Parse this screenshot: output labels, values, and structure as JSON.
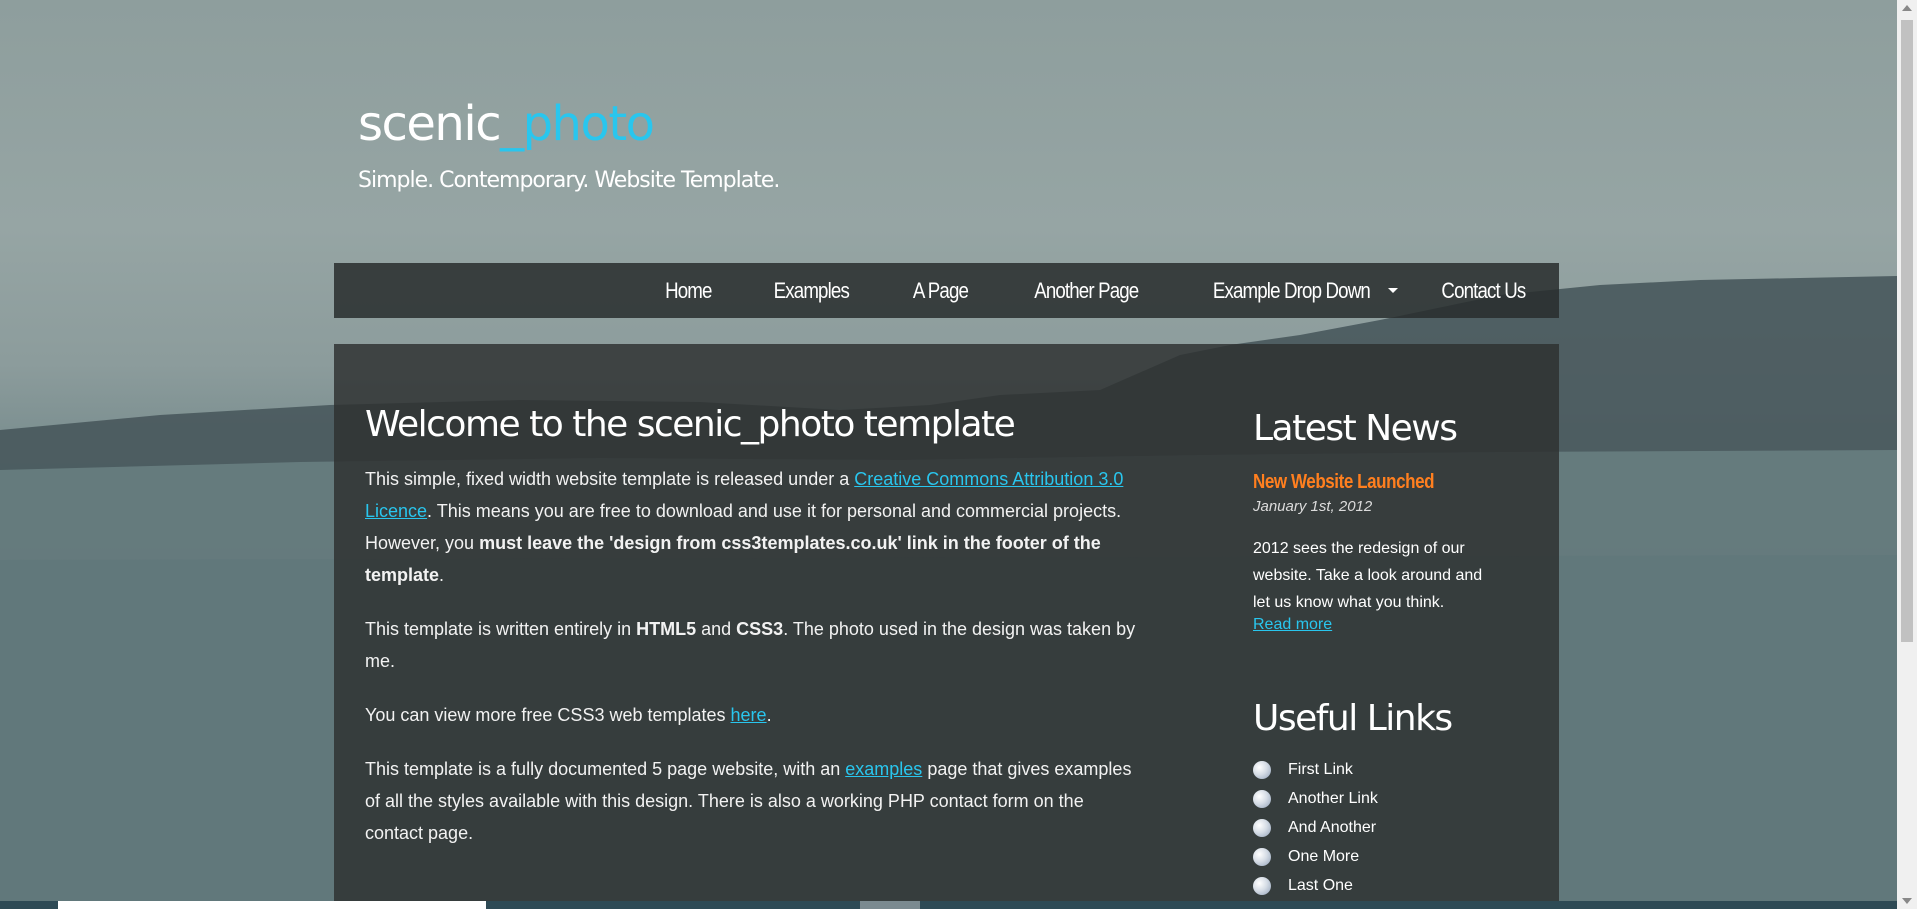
{
  "header": {
    "title_main": "scenic",
    "title_accent": "_photo",
    "slogan": "Simple. Contemporary. Website Template."
  },
  "nav": {
    "items": [
      {
        "label": "Home"
      },
      {
        "label": "Examples"
      },
      {
        "label": "A Page"
      },
      {
        "label": "Another Page"
      },
      {
        "label": "Example Drop Down"
      },
      {
        "label": "Contact Us"
      }
    ]
  },
  "content": {
    "heading": "Welcome to the scenic_photo template",
    "p1": {
      "text_a": "This simple, fixed width website template is released under a ",
      "link": "Creative Commons Attribution 3.0 Licence",
      "text_b": ". This means you are free to download and use it for personal and commercial projects. However, you ",
      "bold": "must leave the 'design from css3templates.co.uk' link in the footer of the template",
      "text_c": "."
    },
    "p2": {
      "text_a": "This template is written entirely in ",
      "bold_a": "HTML5",
      "text_b": " and ",
      "bold_b": "CSS3",
      "text_c": ". The photo used in the design was taken by me."
    },
    "p3": {
      "text_a": "You can view more free CSS3 web templates ",
      "link": "here",
      "text_b": "."
    },
    "p4": {
      "text_a": "This template is a fully documented 5 page website, with an ",
      "link": "examples",
      "text_b": " page that gives examples of all the styles available with this design. There is also a working PHP contact form on the contact page."
    }
  },
  "sidebar": {
    "news_heading": "Latest News",
    "news_title": "New Website Launched",
    "news_date": "January 1st, 2012",
    "news_body": "2012 sees the redesign of our website. Take a look around and let us know what you think.",
    "read_more": "Read more",
    "links_heading": "Useful Links",
    "links": [
      {
        "label": "First Link"
      },
      {
        "label": "Another Link"
      },
      {
        "label": "And Another"
      },
      {
        "label": "One More"
      },
      {
        "label": "Last One"
      }
    ]
  },
  "colors": {
    "accent": "#29c6ee",
    "news_title": "#ff7f1f"
  }
}
